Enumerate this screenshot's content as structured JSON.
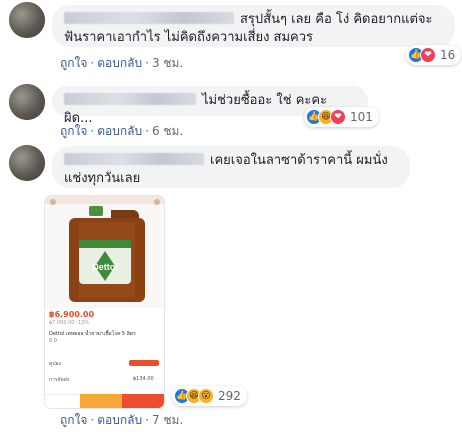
{
  "comments": [
    {
      "text": "สรุปสั้นๆ เลย คือ โง่ คิดอยากแต่จะฟันราคาเอากำไร ไม่คิดถึงความเสี่ยง สมควร",
      "actions": {
        "like": "ถูกใจ",
        "reply": "ตอบกลับ",
        "time": "3 ชม."
      },
      "reactions": {
        "icons": [
          "like-icon",
          "love-icon"
        ],
        "count": "16"
      }
    },
    {
      "text": "ไม่ช่วยซื้ออะ ใช่ คะคะ ผิด...",
      "actions": {
        "like": "ถูกใจ",
        "reply": "ตอบกลับ",
        "time": "6 ชม."
      },
      "reactions": {
        "icons": [
          "like-icon",
          "haha-icon",
          "love-icon"
        ],
        "count": "101"
      }
    },
    {
      "text": "เคยเจอในลาซาด้าราคานี้ ผมนั่งแช่งทุกวันเลย",
      "actions": {
        "like": "ถูกใจ",
        "reply": "ตอบกลับ",
        "time": "7 ชม."
      },
      "reactions": {
        "icons": [
          "like-icon",
          "haha-icon",
          "wow-icon"
        ],
        "count": "292"
      },
      "attachment": {
        "brand": "Dettol",
        "price": "฿6,900.00",
        "old_price": "฿7,000.00 -13%",
        "title": "Dettol เดทตอล น้ำยาฆ่าเชื้อโรค 5 ลิตร",
        "rating": "0.0",
        "coupon_label": "คูปอง",
        "shipping_label": "การจัดส่ง",
        "shipping_price": "฿134.00"
      }
    }
  ],
  "colors": {
    "link": "#385898",
    "bubble": "#f2f3f5",
    "like": "#1877f2",
    "love": "#f33e58",
    "haha": "#f7b125",
    "price": "#ee4d2d"
  }
}
